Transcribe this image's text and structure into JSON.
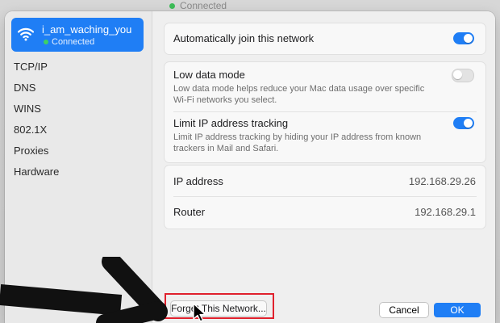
{
  "window": {
    "behind_status": "Connected"
  },
  "sidebar": {
    "network": {
      "icon": "wifi-icon",
      "name": "i_am_waching_you",
      "status": "Connected"
    },
    "items": [
      {
        "label": "TCP/IP"
      },
      {
        "label": "DNS"
      },
      {
        "label": "WINS"
      },
      {
        "label": "802.1X"
      },
      {
        "label": "Proxies"
      },
      {
        "label": "Hardware"
      }
    ]
  },
  "settings": {
    "auto_join": {
      "label": "Automatically join this network",
      "enabled": true
    },
    "low_data": {
      "label": "Low data mode",
      "description": "Low data mode helps reduce your Mac data usage over specific Wi-Fi networks you select.",
      "enabled": false
    },
    "limit_ip": {
      "label": "Limit IP address tracking",
      "description": "Limit IP address tracking by hiding your IP address from known trackers in Mail and Safari.",
      "enabled": true
    }
  },
  "info": {
    "ip_label": "IP address",
    "ip_value": "192.168.29.26",
    "router_label": "Router",
    "router_value": "192.168.29.1"
  },
  "footer": {
    "forget_label": "Forget This Network...",
    "cancel_label": "Cancel",
    "ok_label": "OK"
  },
  "colors": {
    "accent": "#1f7ef5",
    "connected": "#3dd163",
    "highlight": "#e0212d"
  }
}
